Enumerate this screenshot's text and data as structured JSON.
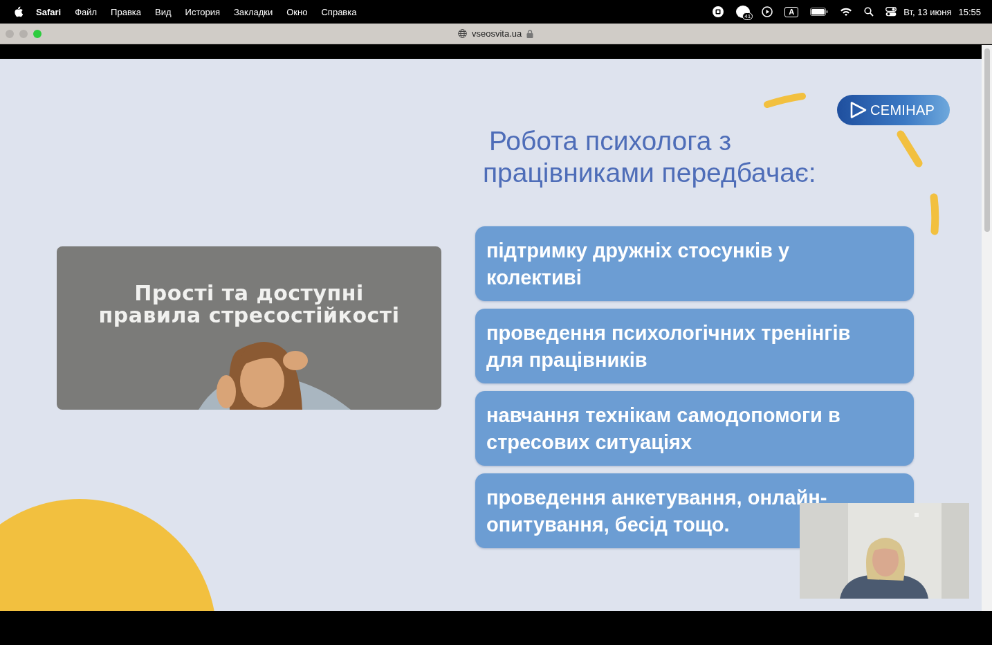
{
  "menu_bar": {
    "app": "Safari",
    "items": [
      "Файл",
      "Правка",
      "Вид",
      "История",
      "Закладки",
      "Окно",
      "Справка"
    ],
    "notification_count": "41",
    "input_source": "A",
    "date": "Вт, 13 июня",
    "time": "15:55"
  },
  "toolbar": {
    "address": "vseosvita.ua"
  },
  "slide": {
    "badge": "СЕМІНАР",
    "title_lines": [
      "Робота психолога з",
      "працівниками передбачає:"
    ],
    "image_caption_lines": [
      "Прості та доступні",
      "правила стресостійкості"
    ],
    "cards": [
      "підтримку дружніх стосунків у колективі",
      "проведення психологічних тренінгів для працівників",
      "навчання технікам самодопомоги в стресових ситуаціях",
      "проведення анкетування, онлайн-опитування, бесід тощо."
    ]
  }
}
